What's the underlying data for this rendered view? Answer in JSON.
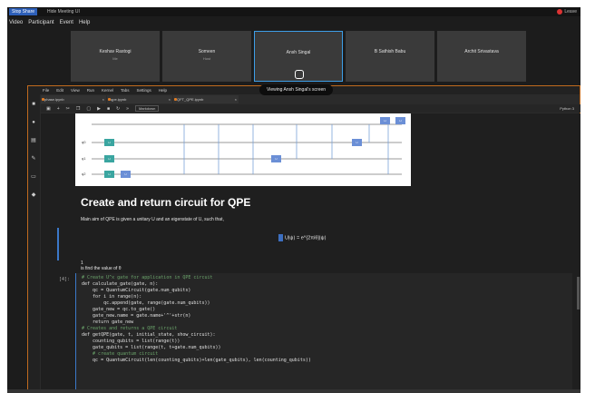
{
  "zoom": {
    "badge": "Stop Share",
    "window_title": "Hide Meeting UI",
    "right_text": "Leave",
    "menu": [
      "Video",
      "Participant",
      "Event",
      "Help"
    ]
  },
  "tiles": [
    {
      "name": "Keshav Rastogi",
      "sub": "Me",
      "active": false
    },
    {
      "name": "Someen",
      "sub": "Host",
      "active": false
    },
    {
      "name": "Ansh Singal",
      "sub": "",
      "active": true
    },
    {
      "name": "B Sathish Babu",
      "sub": "",
      "active": false
    },
    {
      "name": "Archit Srivastava",
      "sub": "",
      "active": false
    }
  ],
  "viewing_label": "Viewing Ansh Singal's screen",
  "jupyter": {
    "menu": [
      "File",
      "Edit",
      "View",
      "Run",
      "Kernel",
      "Tabs",
      "Settings",
      "Help"
    ],
    "tabs": [
      {
        "name": "phase.ipynb"
      },
      {
        "name": "qpe.ipynb"
      },
      {
        "name": "QFT_QPE.ipynb"
      }
    ],
    "toolbar_icons": [
      "save-icon",
      "plus-icon",
      "cut-icon",
      "copy-icon",
      "paste-icon",
      "run-icon",
      "stop-icon",
      "restart-icon",
      "fast-forward-icon"
    ],
    "cell_type": "Markdown",
    "kernel": "Python 3"
  },
  "circuit": {
    "qubits": [
      "q0",
      "q1",
      "q2"
    ],
    "gates": [
      "H",
      "H",
      "H",
      "U",
      "U",
      "U",
      "H",
      "H"
    ]
  },
  "markdown": {
    "heading": "Create and return circuit for QPE",
    "para1": "Main aim of QPE is given a unitary U and an eigenstate of U, such that,",
    "equation": "U|ψ⟩ = e^{2πiθ}|ψ⟩",
    "bullet": "1",
    "para2": "is find the value of θ"
  },
  "code": {
    "prompt": "[4]:",
    "lines": [
      "# Create U^x gate for application in QPE circuit",
      "def calculate_gate(gate, n):",
      "    qc = QuantumCircuit(gate.num_qubits)",
      "    for i in range(n):",
      "        qc.append(gate, range(gate.num_qubits))",
      "    gate_new = qc.to_gate()",
      "    gate_new.name = gate.name+'^'+str(n)",
      "    return gate_new",
      "",
      "# Creates and returns a QPE circuit",
      "def getQPE(gate, t, initial_state, show_circuit):",
      "    counting_qubits = list(range(t))",
      "    gate_qubits = list(range(t, t+gate.num_qubits))",
      "",
      "    # create quantum circuit",
      "    qc = QuantumCircuit(len(counting_qubits)+len(gate_qubits), len(counting_qubits))"
    ]
  },
  "colors": {
    "accent": "#3d9fe8",
    "share_border": "#c06a1e",
    "gate": "#3aa5a0"
  }
}
